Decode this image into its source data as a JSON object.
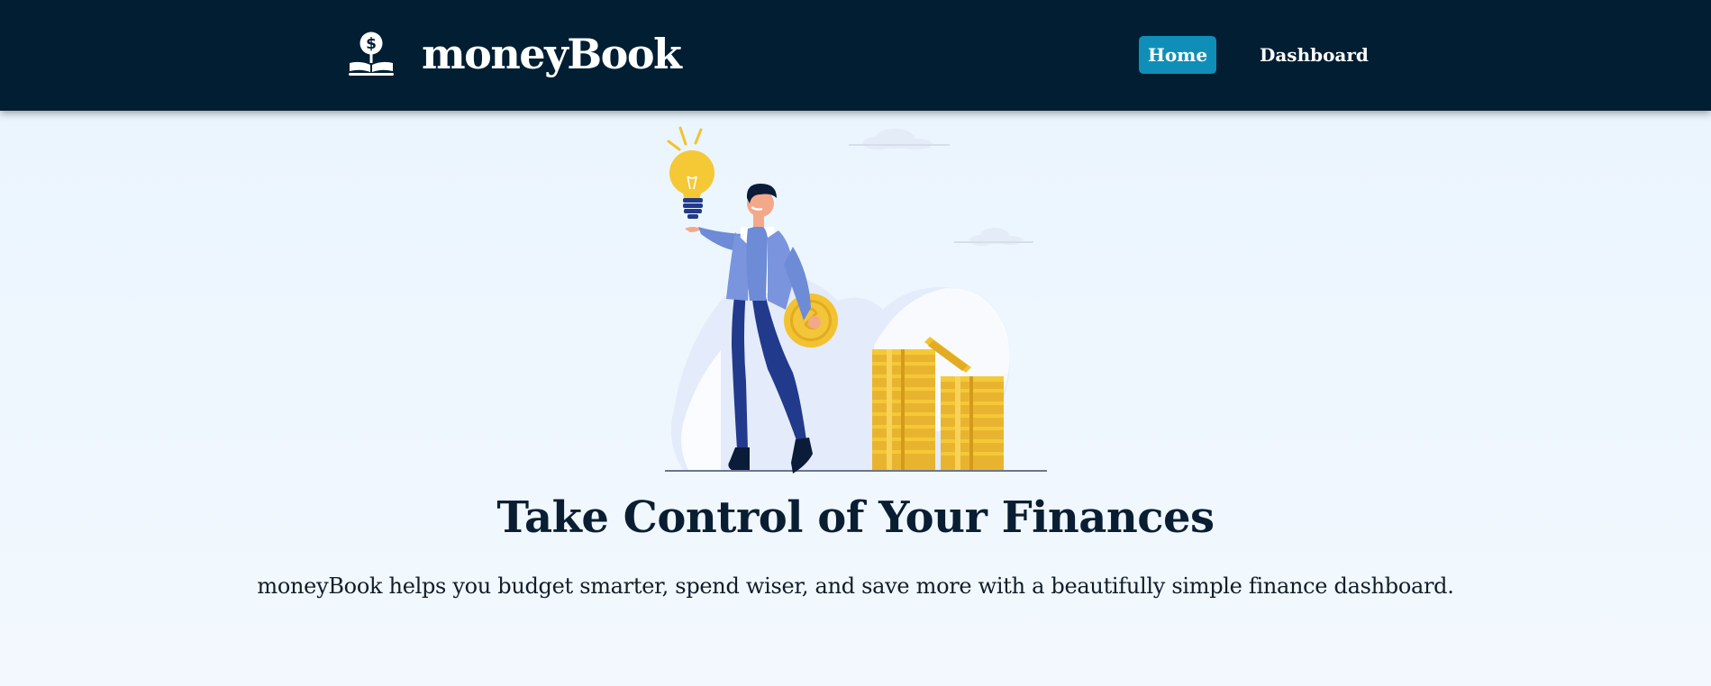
{
  "brand": {
    "name": "moneyBook",
    "icon": "dollar-book-icon"
  },
  "nav": {
    "items": [
      {
        "label": "Home",
        "active": true
      },
      {
        "label": "Dashboard",
        "active": false
      }
    ]
  },
  "hero": {
    "illustration": "man-with-lightbulb-and-coins",
    "title": "Take Control of Your Finances",
    "subtitle": "moneyBook helps you budget smarter, spend wiser, and save more with a beautifully simple finance dashboard."
  },
  "colors": {
    "navbar_bg": "#011e33",
    "accent": "#0f8fb8",
    "page_bg": "#ebf5fd",
    "title_text": "#0a1e33",
    "coin_gold": "#f2c230",
    "jacket_blue": "#6d8bd6",
    "pants_navy": "#223a8c"
  }
}
